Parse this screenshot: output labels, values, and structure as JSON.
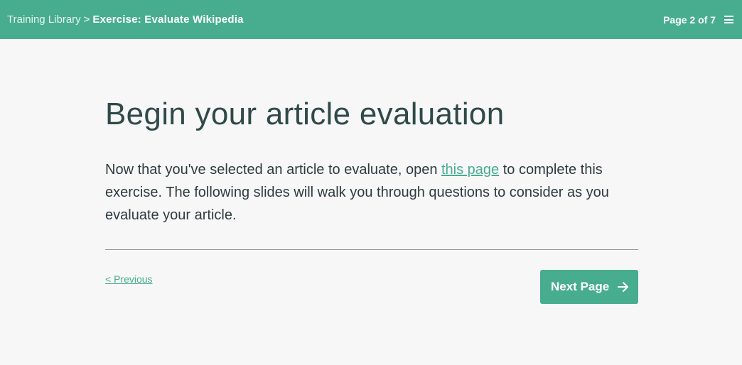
{
  "header": {
    "breadcrumb_root": "Training Library",
    "breadcrumb_separator": ">",
    "breadcrumb_current": "Exercise: Evaluate Wikipedia",
    "page_indicator": "Page 2 of 7",
    "menu_icon": "hamburger-menu-icon"
  },
  "main": {
    "title": "Begin your article evaluation",
    "body_before_link": "Now that you've selected an article to evaluate, open ",
    "body_link": "this page",
    "body_after_link": " to complete this exercise. The following slides will walk you through questions to consider as you evaluate your article."
  },
  "navigation": {
    "previous_label": "< Previous",
    "next_label": "Next Page",
    "next_icon": "arrow-right-icon"
  },
  "colors": {
    "accent": "#47ad8e",
    "background": "#f7f7f7",
    "text": "#2f3b3f"
  }
}
